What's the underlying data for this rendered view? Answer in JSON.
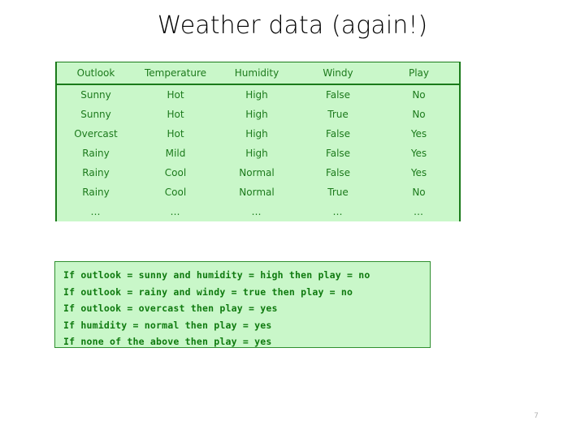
{
  "slide": {
    "title": "Weather data (again!)",
    "page_number": "7",
    "colors": {
      "table_fill": "#c9f7c9",
      "table_border": "#1a7a1a",
      "table_text": "#1c7a1c",
      "rules_fill": "#c9f7c9",
      "rules_border": "#2f8f2f",
      "rules_text": "#0f7a0f",
      "title_text": "#000000",
      "page_number_text": "#b3b3b3",
      "background": "#ffffff"
    }
  },
  "table": {
    "columns": [
      "Outlook",
      "Temperature",
      "Humidity",
      "Windy",
      "Play"
    ],
    "rows": [
      [
        "Sunny",
        "Hot",
        "High",
        "False",
        "No"
      ],
      [
        "Sunny",
        "Hot",
        "High",
        "True",
        "No"
      ],
      [
        "Overcast",
        "Hot",
        "High",
        "False",
        "Yes"
      ],
      [
        "Rainy",
        "Mild",
        "High",
        "False",
        "Yes"
      ],
      [
        "Rainy",
        "Cool",
        "Normal",
        "False",
        "Yes"
      ],
      [
        "Rainy",
        "Cool",
        "Normal",
        "True",
        "No"
      ],
      [
        "…",
        "…",
        "…",
        "…",
        "…"
      ]
    ]
  },
  "rules": {
    "lines": [
      "If outlook = sunny and humidity = high then play = no",
      "If outlook = rainy and windy = true then play = no",
      "If outlook = overcast then play = yes",
      "If humidity = normal then play = yes",
      "If none of the above then play = yes"
    ]
  }
}
